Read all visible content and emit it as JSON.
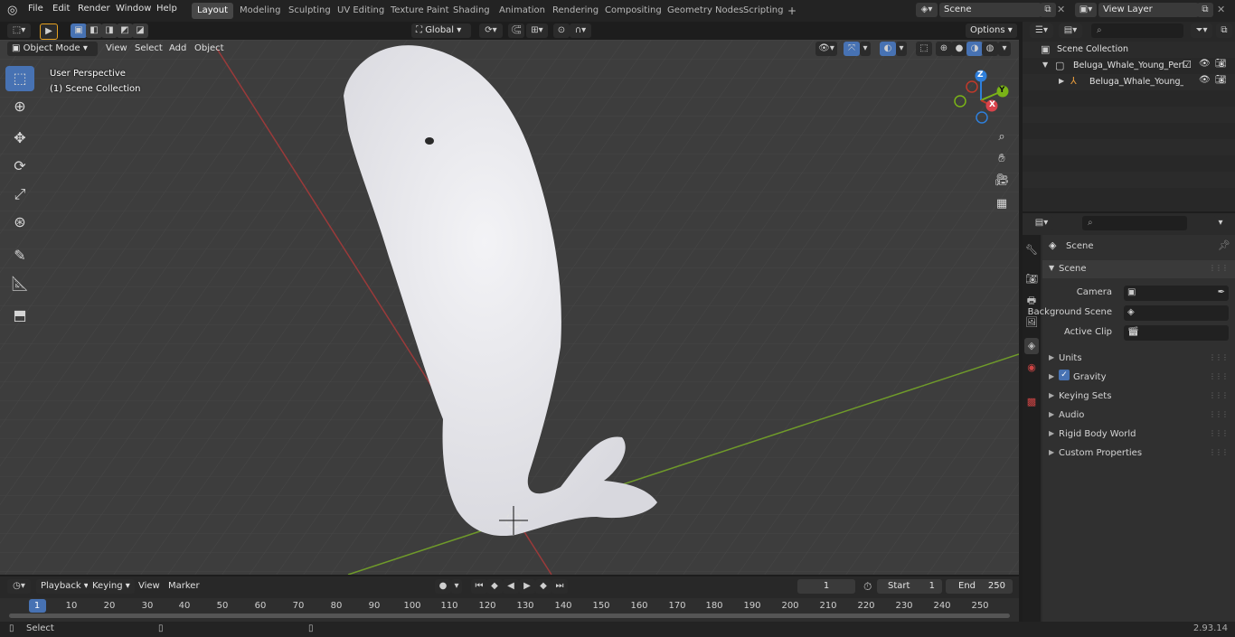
{
  "menu": [
    "File",
    "Edit",
    "Render",
    "Window",
    "Help"
  ],
  "workspaces": [
    "Layout",
    "Modeling",
    "Sculpting",
    "UV Editing",
    "Texture Paint",
    "Shading",
    "Animation",
    "Rendering",
    "Compositing",
    "Geometry Nodes",
    "Scripting"
  ],
  "active_workspace": "Layout",
  "scene_field": "Scene",
  "view_layer_field": "View Layer",
  "viewport": {
    "mode": "Object Mode",
    "menus": [
      "View",
      "Select",
      "Add",
      "Object"
    ],
    "transform_orientation": "Global",
    "options_label": "Options",
    "perspective_label": "User Perspective",
    "collection_label": "(1) Scene Collection",
    "gizmo_axes": [
      "Z",
      "Y",
      "X"
    ]
  },
  "outliner": {
    "root": "Scene Collection",
    "items": [
      "Beluga_Whale_Young_Perform",
      "Beluga_Whale_Young_Pe"
    ]
  },
  "properties": {
    "context_title": "Scene",
    "panel_title": "Scene",
    "camera_label": "Camera",
    "background_scene_label": "Background Scene",
    "active_clip_label": "Active Clip",
    "sections": [
      "Units",
      "Gravity",
      "Keying Sets",
      "Audio",
      "Rigid Body World",
      "Custom Properties"
    ],
    "gravity_checked": true
  },
  "timeline": {
    "menus": [
      "Playback",
      "Keying",
      "View",
      "Marker"
    ],
    "current_frame": "1",
    "start_label": "Start",
    "start_value": "1",
    "end_label": "End",
    "end_value": "250",
    "ruler": [
      "1",
      "10",
      "20",
      "30",
      "40",
      "50",
      "60",
      "70",
      "80",
      "90",
      "100",
      "110",
      "120",
      "130",
      "140",
      "150",
      "160",
      "170",
      "180",
      "190",
      "200",
      "210",
      "220",
      "230",
      "240",
      "250"
    ]
  },
  "status": {
    "left": "Select",
    "version": "2.93.14"
  },
  "colors": {
    "accent": "#4772b3",
    "x_axis": "#c0392b",
    "y_axis": "#7ab317",
    "z_axis": "#2e7fdb"
  }
}
